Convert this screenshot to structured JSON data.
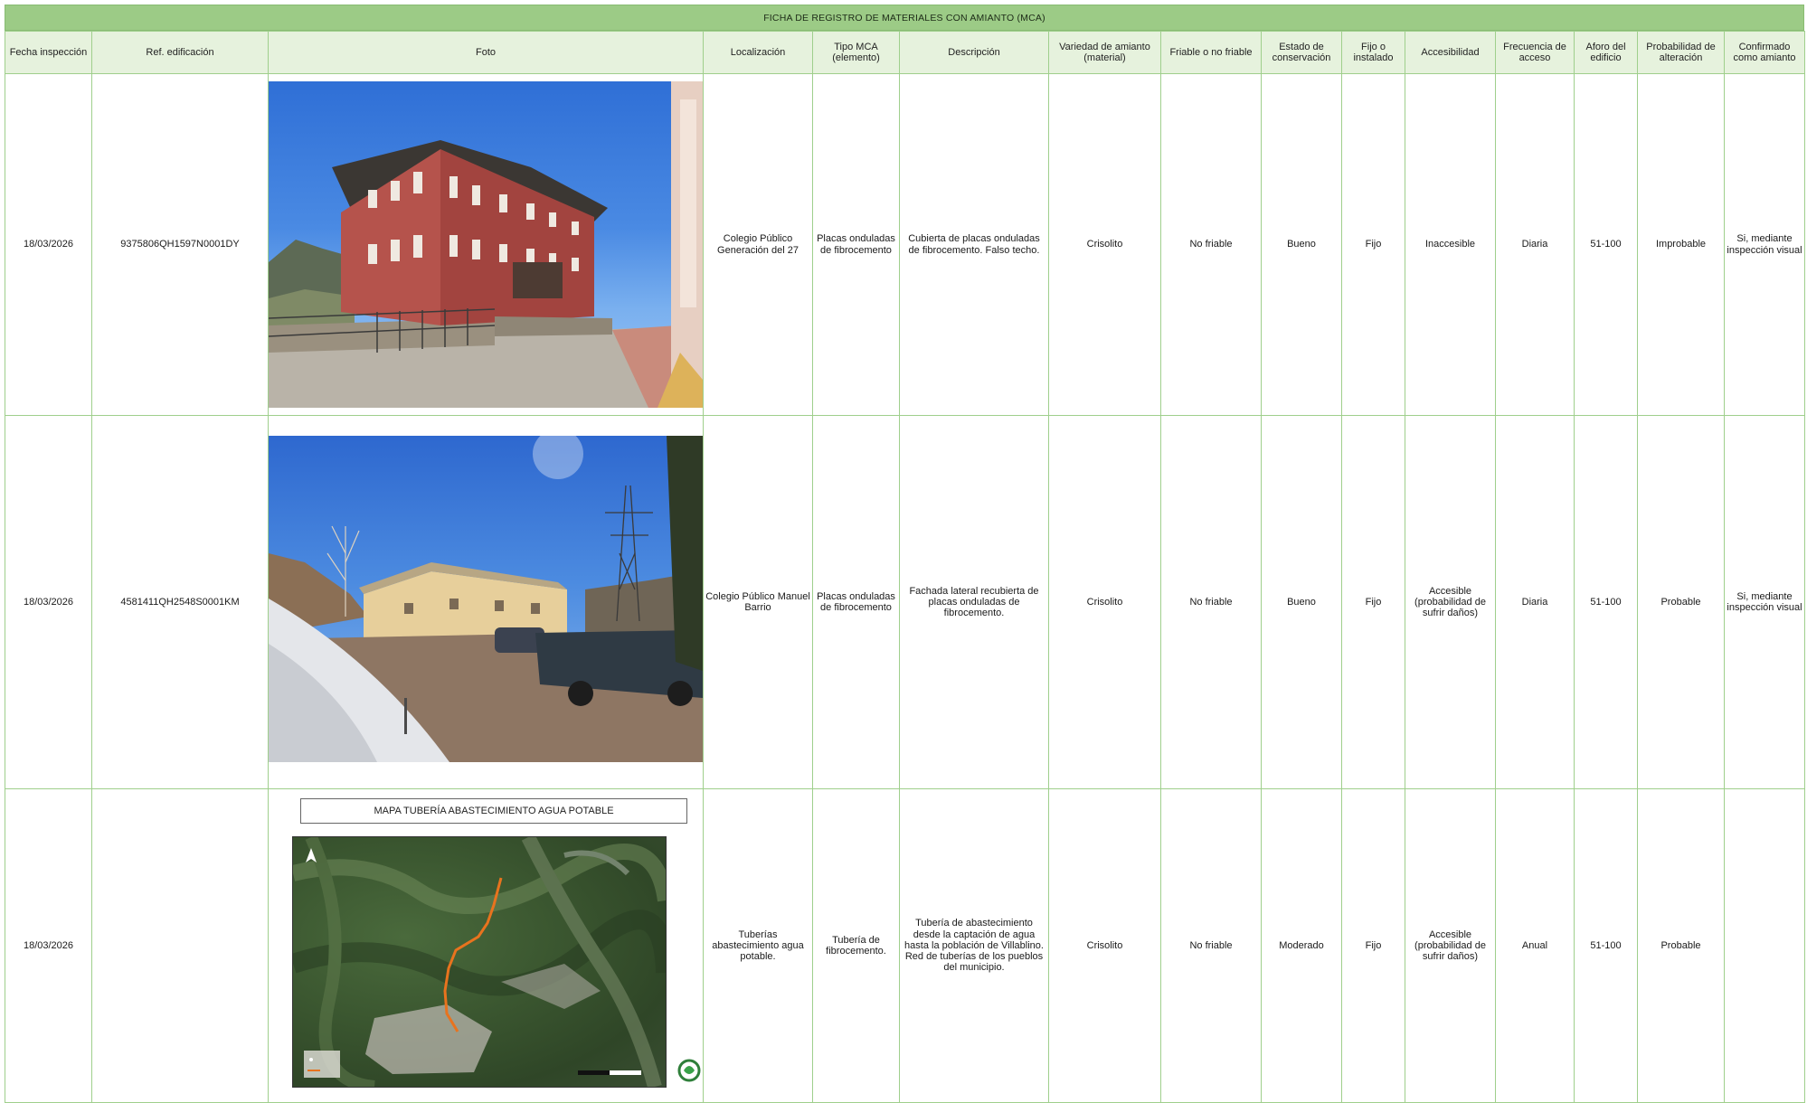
{
  "title": "FICHA DE REGISTRO DE MATERIALES CON AMIANTO (MCA)",
  "columns": [
    "Fecha inspección",
    "Ref. edificación",
    "Foto",
    "Localización",
    "Tipo MCA (elemento)",
    "Descripción",
    "Variedad de amianto (material)",
    "Friable o no friable",
    "Estado de conservación",
    "Fijo o instalado",
    "Accesibilidad",
    "Frecuencia de acceso",
    "Aforo del edificio",
    "Probabilidad de alteración",
    "Confirmado como amianto"
  ],
  "rows": [
    {
      "fecha": "18/03/2026",
      "ref": "9375806QH1597N0001DY",
      "localizacion": "Colegio Público Generación del 27",
      "tipo": "Placas onduladas de fibrocemento",
      "descripcion": "Cubierta de placas onduladas de fibrocemento. Falso techo.",
      "variedad": "Crisolito",
      "friable": "No friable",
      "estado": "Bueno",
      "fijo": "Fijo",
      "accesibilidad": "Inaccesible",
      "frecuencia": "Diaria",
      "aforo": "51-100",
      "probabilidad": "Improbable",
      "confirmado": "Si, mediante inspección visual"
    },
    {
      "fecha": "18/03/2026",
      "ref": "4581411QH2548S0001KM",
      "localizacion": "Colegio Público Manuel Barrio",
      "tipo": "Placas onduladas de fibrocemento",
      "descripcion": "Fachada lateral recubierta de placas onduladas de fibrocemento.",
      "variedad": "Crisolito",
      "friable": "No friable",
      "estado": "Bueno",
      "fijo": "Fijo",
      "accesibilidad": "Accesible (probabilidad de sufrir daños)",
      "frecuencia": "Diaria",
      "aforo": "51-100",
      "probabilidad": "Probable",
      "confirmado": "Si, mediante inspección visual"
    },
    {
      "fecha": "18/03/2026",
      "ref": "",
      "localizacion": "Tuberías abastecimiento agua potable.",
      "tipo": "Tubería de fibrocemento.",
      "descripcion": "Tubería de abastecimiento desde la captación de agua hasta la población de Villablino. Red de tuberías de los pueblos del municipio.",
      "variedad": "Crisolito",
      "friable": "No friable",
      "estado": "Moderado",
      "fijo": "Fijo",
      "accesibilidad": "Accesible (probabilidad de sufrir daños)",
      "frecuencia": "Anual",
      "aforo": "51-100",
      "probabilidad": "Probable",
      "confirmado": "",
      "map_title": "MAPA TUBERÍA ABASTECIMIENTO AGUA POTABLE"
    }
  ],
  "colors": {
    "title_bar": "#9ccb86",
    "header_bg": "#e6f2dd",
    "grid": "#9fcf8c",
    "pipe": "#e8731e"
  },
  "icons": [
    "north-arrow-icon",
    "logo-icon"
  ]
}
